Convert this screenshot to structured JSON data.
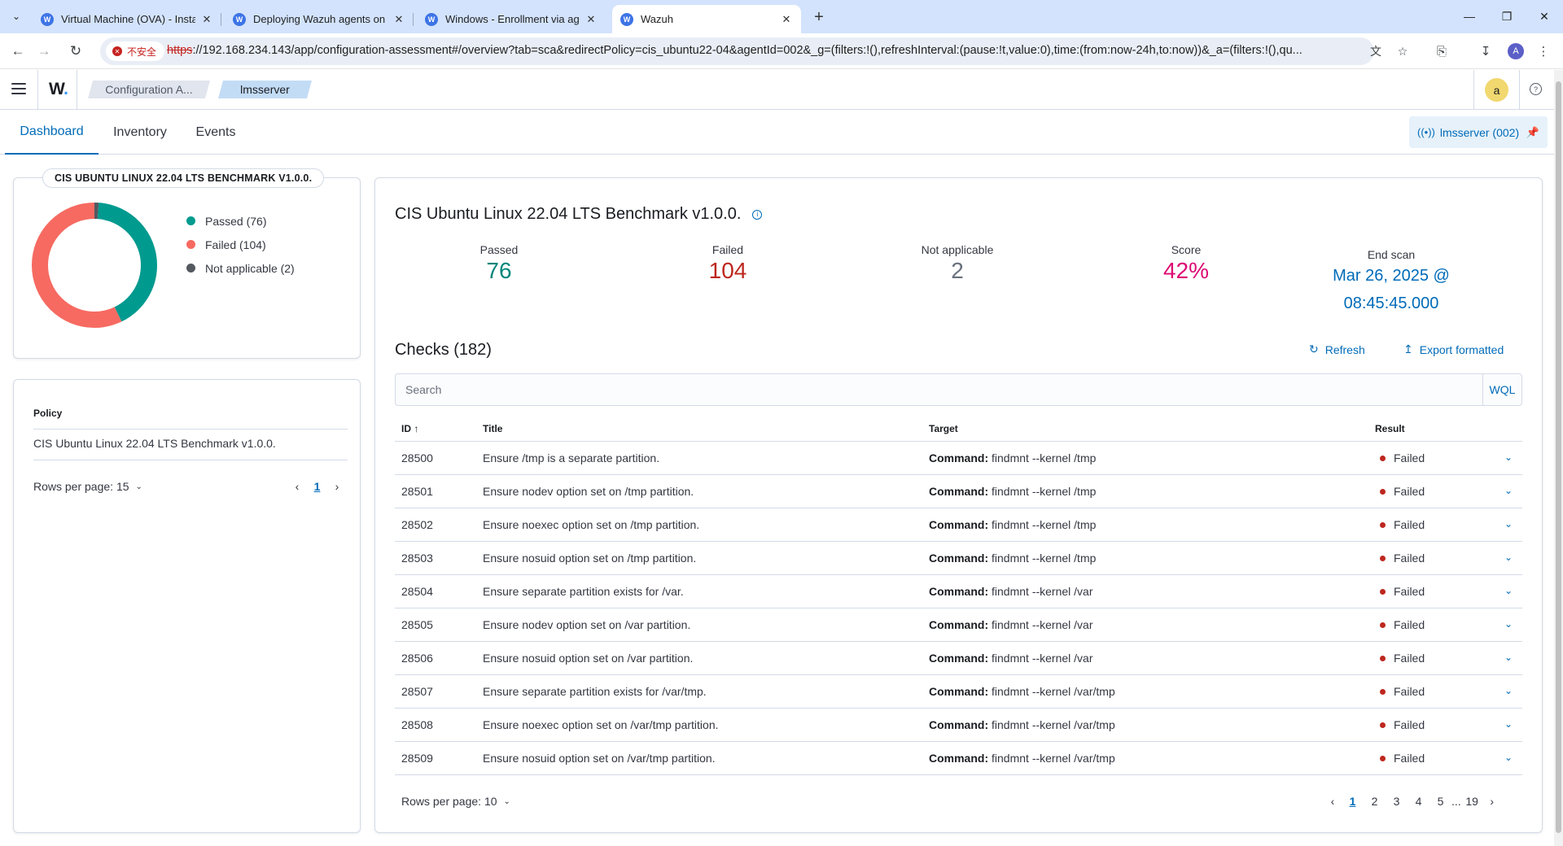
{
  "browser": {
    "tabs": [
      {
        "label": "Virtual Machine (OVA) - Insta",
        "active": false
      },
      {
        "label": "Deploying Wazuh agents on",
        "active": false
      },
      {
        "label": "Windows - Enrollment via ag",
        "active": false
      },
      {
        "label": "Wazuh",
        "active": true
      }
    ],
    "security_label": "不安全",
    "url_protocol": "https",
    "url_rest": "://192.168.234.143/app/configuration-assessment#/overview?tab=sca&redirectPolicy=cis_ubuntu22-04&agentId=002&_g=(filters:!(),refreshInterval:(pause:!t,value:0),time:(from:now-24h,to:now))&_a=(filters:!(),qu...",
    "profile_initial": "A"
  },
  "header": {
    "logo": "W",
    "breadcrumbs": [
      "Configuration A...",
      "lmsserver"
    ],
    "avatar_initial": "a"
  },
  "subtabs": [
    "Dashboard",
    "Inventory",
    "Events"
  ],
  "agent_pill": "lmsserver (002)",
  "summary_card": {
    "title": "CIS UBUNTU LINUX 22.04 LTS BENCHMARK V1.0.0.",
    "legend": [
      {
        "label": "Passed (76)",
        "color": "#009a8f"
      },
      {
        "label": "Failed (104)",
        "color": "#f66a61"
      },
      {
        "label": "Not applicable (2)",
        "color": "#54585f"
      }
    ]
  },
  "chart_data": {
    "type": "pie",
    "donut": true,
    "categories": [
      "Passed",
      "Failed",
      "Not applicable"
    ],
    "values": [
      76,
      104,
      2
    ],
    "colors": [
      "#009a8f",
      "#f66a61",
      "#54585f"
    ]
  },
  "policy_card": {
    "header": "Policy",
    "policy": "CIS Ubuntu Linux 22.04 LTS Benchmark v1.0.0.",
    "rows_per_page": "Rows per page: 15",
    "pages": [
      "1"
    ]
  },
  "main": {
    "title": "CIS Ubuntu Linux 22.04 LTS Benchmark v1.0.0.",
    "stats": [
      {
        "label": "Passed",
        "value": "76"
      },
      {
        "label": "Failed",
        "value": "104"
      },
      {
        "label": "Not applicable",
        "value": "2"
      },
      {
        "label": "Score",
        "value": "42%"
      }
    ],
    "end_scan_label": "End scan",
    "end_scan_line1": "Mar 26, 2025 @",
    "end_scan_line2": "08:45:45.000",
    "checks_title": "Checks (182)",
    "refresh_label": "Refresh",
    "export_label": "Export formatted",
    "search_placeholder": "Search",
    "wql_label": "WQL",
    "columns": {
      "id": "ID",
      "title": "Title",
      "target": "Target",
      "result": "Result"
    },
    "target_prefix": "Command:",
    "rows": [
      {
        "id": "28500",
        "title": "Ensure /tmp is a separate partition.",
        "target": "findmnt --kernel /tmp",
        "result": "Failed"
      },
      {
        "id": "28501",
        "title": "Ensure nodev option set on /tmp partition.",
        "target": "findmnt --kernel /tmp",
        "result": "Failed"
      },
      {
        "id": "28502",
        "title": "Ensure noexec option set on /tmp partition.",
        "target": "findmnt --kernel /tmp",
        "result": "Failed"
      },
      {
        "id": "28503",
        "title": "Ensure nosuid option set on /tmp partition.",
        "target": "findmnt --kernel /tmp",
        "result": "Failed"
      },
      {
        "id": "28504",
        "title": "Ensure separate partition exists for /var.",
        "target": "findmnt --kernel /var",
        "result": "Failed"
      },
      {
        "id": "28505",
        "title": "Ensure nodev option set on /var partition.",
        "target": "findmnt --kernel /var",
        "result": "Failed"
      },
      {
        "id": "28506",
        "title": "Ensure nosuid option set on /var partition.",
        "target": "findmnt --kernel /var",
        "result": "Failed"
      },
      {
        "id": "28507",
        "title": "Ensure separate partition exists for /var/tmp.",
        "target": "findmnt --kernel /var/tmp",
        "result": "Failed"
      },
      {
        "id": "28508",
        "title": "Ensure noexec option set on /var/tmp partition.",
        "target": "findmnt --kernel /var/tmp",
        "result": "Failed"
      },
      {
        "id": "28509",
        "title": "Ensure nosuid option set on /var/tmp partition.",
        "target": "findmnt --kernel /var/tmp",
        "result": "Failed"
      }
    ],
    "rows_per_page": "Rows per page: 10",
    "pages": [
      "1",
      "2",
      "3",
      "4",
      "5",
      "...",
      "19"
    ]
  }
}
